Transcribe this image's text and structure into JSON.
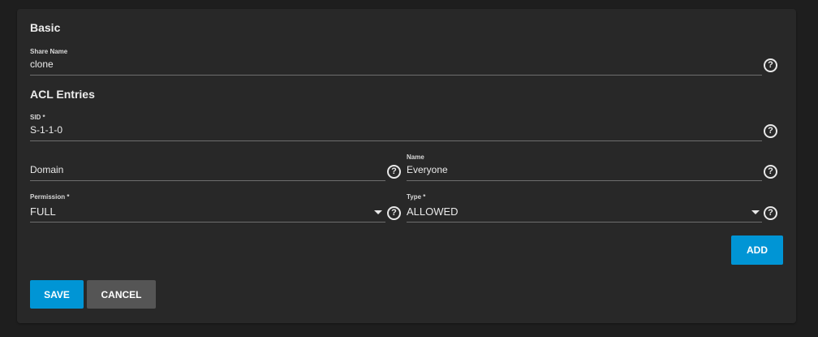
{
  "form": {
    "basic": {
      "title": "Basic",
      "share_name": {
        "label": "Share Name",
        "value": "clone"
      }
    },
    "acl": {
      "title": "ACL Entries",
      "sid": {
        "label": "SID *",
        "value": "S-1-1-0"
      },
      "domain": {
        "label": "",
        "value": "Domain"
      },
      "name": {
        "label": "Name",
        "value": "Everyone"
      },
      "permission": {
        "label": "Permission *",
        "value": "FULL"
      },
      "type": {
        "label": "Type *",
        "value": "ALLOWED"
      },
      "add_label": "ADD"
    },
    "actions": {
      "save_label": "SAVE",
      "cancel_label": "CANCEL"
    }
  },
  "icons": {
    "help": "question-circle-icon",
    "dropdown": "caret-down-icon"
  },
  "colors": {
    "background": "#1e1e1e",
    "card": "#282828",
    "primary": "#0095d5",
    "secondary": "#555555",
    "underline": "#6e6e6e"
  }
}
